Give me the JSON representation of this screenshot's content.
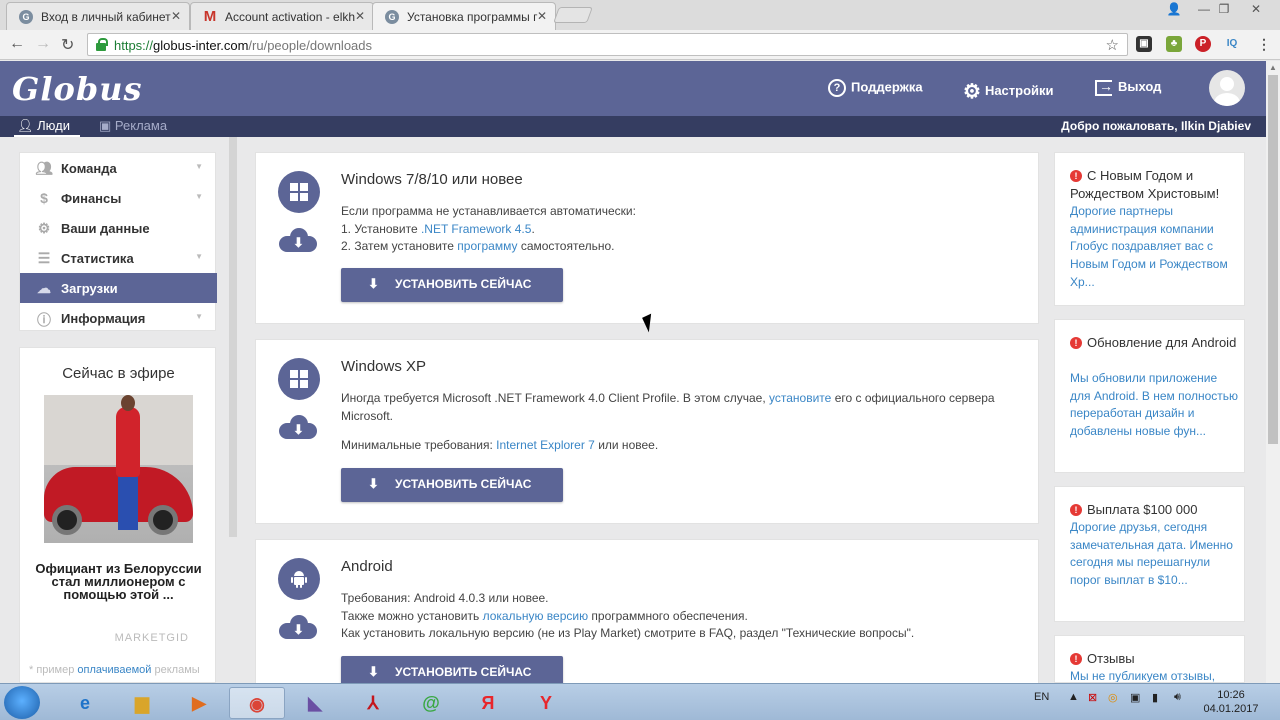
{
  "browser": {
    "tabs": [
      {
        "title": "Вход в личный кабинет",
        "icon": "globe-icon"
      },
      {
        "title": "Account activation - elkh",
        "icon": "gmail-icon"
      },
      {
        "title": "Установка программы г",
        "icon": "globe-icon"
      }
    ],
    "url_scheme": "https://",
    "url_host": "globus-inter.com",
    "url_path": "/ru/people/downloads"
  },
  "header": {
    "logo": "Globus",
    "support": "Поддержка",
    "settings": "Настройки",
    "logout": "Выход",
    "subtabs": [
      "Люди",
      "Реклама"
    ],
    "welcome": "Добро пожаловать, Ilkin Djabiev"
  },
  "sidebar": {
    "items": [
      {
        "label": "Команда",
        "icon": "team-icon",
        "caret": true
      },
      {
        "label": "Финансы",
        "icon": "dollar-icon",
        "caret": true
      },
      {
        "label": "Ваши данные",
        "icon": "gear-icon",
        "caret": false
      },
      {
        "label": "Статистика",
        "icon": "list-icon",
        "caret": true
      },
      {
        "label": "Загрузки",
        "icon": "cloud-download-icon",
        "caret": false,
        "active": true
      },
      {
        "label": "Информация",
        "icon": "info-icon",
        "caret": true
      }
    ]
  },
  "ad": {
    "title": "Сейчас в эфире",
    "text": "Официант из Белоруссии стал миллионером с помощью этой ...",
    "source": "MARKETGID",
    "footer_pre": "* пример",
    "footer_link": "оплачиваемой",
    "footer_post": "рекламы"
  },
  "downloads": [
    {
      "title": "Windows 7/8/10 или новее",
      "line1": "Если программа не устанавливается автоматически:",
      "line2_pre": "1. Установите ",
      "line2_link": ".NET Framework 4.5",
      "line2_post": ".",
      "line3_pre": "2. Затем установите ",
      "line3_link": "программу",
      "line3_post": " самостоятельно.",
      "button": "УСТАНОВИТЬ СЕЙЧАС"
    },
    {
      "title": "Windows XP",
      "line1_pre": "Иногда требуется Microsoft .NET Framework 4.0 Client Profile. В этом случае, ",
      "line1_link": "установите",
      "line1_post": " его с официального сервера",
      "line2": "Microsoft.",
      "line3_pre": "Минимальные требования: ",
      "line3_link": "Internet Explorer 7",
      "line3_post": " или новее.",
      "button": "УСТАНОВИТЬ СЕЙЧАС"
    },
    {
      "title": "Android",
      "line1": "Требования: Android 4.0.3 или новее.",
      "line2_pre": "Также можно установить ",
      "line2_link": "локальную версию",
      "line2_post": " программного обеспечения.",
      "line3": "Как установить локальную версию (не из Play Market) смотрите в FAQ, раздел \"Технические вопросы\".",
      "button": "УСТАНОВИТЬ СЕЙЧАС"
    }
  ],
  "news": [
    {
      "title": "С Новым Годом и Рождеством Христовым!",
      "body": "Дорогие партнеры администрация компании Глобус поздравляет вас с Новым Годом и Рождеством Хр..."
    },
    {
      "title": "Обновление для Android",
      "body": "Мы обновили приложение для Android. В нем полностью переработан дизайн и добавлены новые фун..."
    },
    {
      "title": "Выплата $100 000",
      "body": "Дорогие друзья, сегодня замечательная дата. Именно сегодня мы перешагнули порог выплат в $10..."
    },
    {
      "title": "Отзывы",
      "body": "Мы не публикуем отзывы,"
    }
  ],
  "taskbar": {
    "lang": "EN",
    "time": "10:26",
    "date": "04.01.2017"
  },
  "colors": {
    "brand": "#5c6596",
    "brand_dark": "#353d61",
    "link": "#3a86c6",
    "alert": "#e53935"
  }
}
